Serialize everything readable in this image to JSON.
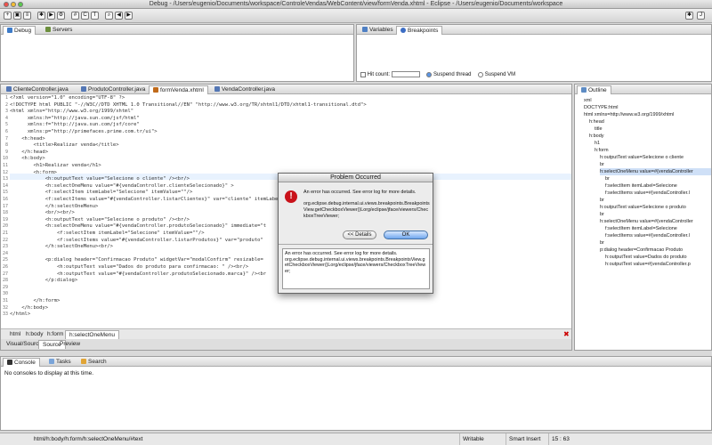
{
  "window": {
    "title": "Debug - /Users/eugenio/Documents/workspace/ControleVendas/WebContent/view/formVenda.xhtml - Eclipse - /Users/eugenio/Documents/workspace"
  },
  "panels": {
    "debug": {
      "tabs": [
        "Debug",
        "Servers"
      ]
    },
    "variables": {
      "tabs": [
        "Variables",
        "Breakpoints"
      ],
      "hit_count_label": "Hit count:",
      "suspend_thread": "Suspend thread",
      "suspend_vm": "Suspend VM"
    },
    "outline": {
      "title": "Outline",
      "items": [
        "xml",
        "DOCTYPE:html",
        "html xmlns=http://www.w3.org/1999/xhtml",
        "h:head",
        "title",
        "h:body",
        "h1",
        "h:form",
        "h:outputText value=Selecione o cliente",
        "br",
        "h:selectOneMenu value=#{vendaController",
        "br",
        "f:selectItem itemLabel=Selecione",
        "f:selectItems value=#{vendaController.l",
        "br",
        "h:outputText value=Selecione o produto",
        "br",
        "h:selectOneMenu value=#{vendaController",
        "f:selectItem itemLabel=Selecione",
        "f:selectItems value=#{vendaController.l",
        "br",
        "p:dialog header=Confirmacao Produto",
        "h:outputText value=Dados do produto",
        "h:outputText value=#{vendaController.p"
      ]
    },
    "console": {
      "tabs": [
        "Console",
        "Tasks",
        "Search"
      ],
      "message": "No consoles to display at this time."
    }
  },
  "editor": {
    "tabs": [
      "ClienteController.java",
      "ProdutoController.java",
      "formVenda.xhtml",
      "VendaController.java"
    ],
    "breadcrumb": [
      "html",
      "h:body",
      "h:form",
      "h:selectOneMenu"
    ],
    "bottom_tabs": [
      "Visual/Source",
      "Source",
      "Preview"
    ],
    "line_numbers": [
      "1",
      "2",
      "3",
      "4",
      "5",
      "6",
      "7",
      "8",
      "9",
      "10",
      "11",
      "12",
      "13",
      "14",
      "15",
      "16",
      "17",
      "18",
      "19",
      "20",
      "21",
      "22",
      "23",
      "24",
      "25",
      "26",
      "27",
      "28",
      "29",
      "30",
      "31",
      "32",
      "33"
    ],
    "lines": [
      "<?xml version=\"1.0\" encoding=\"UTF-8\" ?>",
      "<!DOCTYPE html PUBLIC \"-//W3C//DTD XHTML 1.0 Transitional//EN\" \"http://www.w3.org/TR/xhtml1/DTD/xhtml1-transitional.dtd\">",
      "<html xmlns=\"http://www.w3.org/1999/xhtml\"",
      "      xmlns:h=\"http://java.sun.com/jsf/html\"",
      "      xmlns:f=\"http://java.sun.com/jsf/core\"",
      "      xmlns:p=\"http://primefaces.prime.com.tr/ui\">",
      "    <h:head>",
      "        <title>Realizar venda</title>",
      "    </h:head>",
      "    <h:body>",
      "        <h1>Realizar venda</h1>",
      "        <h:form>",
      "            <h:outputText value=\"Selecione o cliente\" /><br/>",
      "            <h:selectOneMenu value=\"#{vendaController.clienteSelecionado}\" >",
      "            <f:selectItem itemLabel=\"Selecione\" itemValue=\"\"/>",
      "            <f:selectItems value=\"#{vendaController.listarClientes}\" var=\"cliente\" itemLabel=",
      "            </h:selectOneMenu>",
      "            <br/><br/>",
      "            <h:outputText value=\"Selecione o produto\" /><br/>",
      "            <h:selectOneMenu value=\"#{vendaController.produtoSelecionado}\" immediate=\"t",
      "                <f:selectItem itemLabel=\"Selecione\" itemValue=\"\"/>",
      "                <f:selectItems value=\"#{vendaController.listarProdutos}\" var=\"produto\"",
      "            </h:selectOneMenu><br/>",
      "",
      "            <p:dialog header=\"Confirmacao Produto\" widgetVar=\"modalConfirm\" resizable=",
      "                <h:outputText value=\"Dados do produto para confirmacao: \" /><br/>",
      "                <h:outputText value=\"#{vendaController.produtoSelecionado.marca}\" /><br",
      "            </p:dialog>",
      "",
      "",
      "        </h:form>",
      "    </h:body>",
      "</html>"
    ]
  },
  "dialog": {
    "title": "Problem Occurred",
    "message": "An error has occurred. See error log for more details.",
    "detail": "org.eclipse.debug.internal.ui.views.breakpoints.BreakpointsView.getCheckboxViewer()Lorg/eclipse/jface/viewers/CheckboxTreeViewer;",
    "details_button": "<< Details",
    "ok_button": "OK",
    "details_text": "An error has occurred. See error log for more details.\norg.eclipse.debug.internal.ui.views.breakpoints.BreakpointsView.getCheckboxViewer()Lorg/eclipse/jface/viewers/CheckboxTreeViewer;"
  },
  "status": {
    "path": "html/h:body/h:form/h:selectOneMenu/#text",
    "mode": "Writable",
    "insert": "Smart Insert",
    "position": "15 : 63"
  }
}
